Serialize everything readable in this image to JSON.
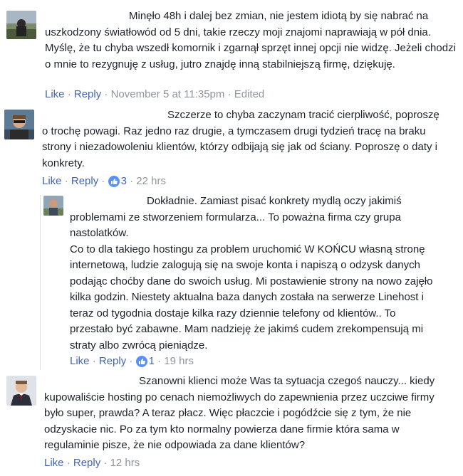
{
  "comments": [
    {
      "id": "c1",
      "text": "Minęło 48h i dalej bez zmian, nie jestem idiotą by się nabrać na uszkodzony światłowód od 5 dni, takie rzeczy moji znajomi naprawiają w pół dnia. Myślę, że tu chyba wszedł komornik i zgarnął sprzęt innej opcji nie widzę. Jeżeli chodzi o mnie to rezygnuję z usług, jutro znajdę inną stabilniejszą firmę, dziękuję.",
      "like_label": "Like",
      "reply_label": "Reply",
      "timestamp": "November 5 at 11:35pm",
      "edited_label": "Edited"
    },
    {
      "id": "c2",
      "text": "Szczerze to chyba zaczynam tracić cierpliwość, poproszę o trochę powagi. Raz jedno raz drugie, a tymczasem drugi tydzień tracę na braku strony i niezadowoleniu klientów, którzy odbijają się jak od ściany. Poproszę o daty i konkrety.",
      "like_label": "Like",
      "reply_label": "Reply",
      "reaction_count": "3",
      "timestamp": "22 hrs"
    },
    {
      "id": "c3",
      "text": "Dokładnie. Zamiast pisać konkrety mydlą oczy jakimiś problemami ze stworzeniem formularza... To poważna firma czy grupa nastolatków.\nCo to dla takiego hostingu za problem uruchomić W KOŃCU własną stronę internetową, ludzie zalogują się na swoje konta i napiszą o odzysk danych podając choćby dane do swoich usług. Mi postawienie strony na nowo zajęło kilka godzin. Niestety aktualna baza danych została na serwerze Linehost i teraz od tygodnia dostaje kilka razy dziennie telefony od klientów.. To przestało być zabawne. Mam nadzieję że jakimś cudem zrekompensują mi straty albo zwrócą pieniądze.",
      "like_label": "Like",
      "reply_label": "Reply",
      "reaction_count": "1",
      "timestamp": "19 hrs"
    },
    {
      "id": "c4",
      "text": "Szanowni klienci może Was ta sytuacja czegoś nauczy... kiedy kupowaliście hosting po cenach niemożliwych do zapewnienia przez uczciwe firmy było super, prawda? A teraz płacz. Więc płaczcie i pogódźcie się z tym, że nie odzyskacie nic. Po za tym kto normalny powierza dane firmie która sama w regulaminie pisze, że nie odpowiada za dane klientów?",
      "like_label": "Like",
      "reply_label": "Reply",
      "timestamp": "12 hrs"
    }
  ],
  "colors": {
    "link": "#4267b2",
    "meta": "#90949c",
    "text": "#1d2129",
    "like_icon": "#5890ff"
  },
  "icons": {
    "reaction": "thumbs-up-icon"
  }
}
